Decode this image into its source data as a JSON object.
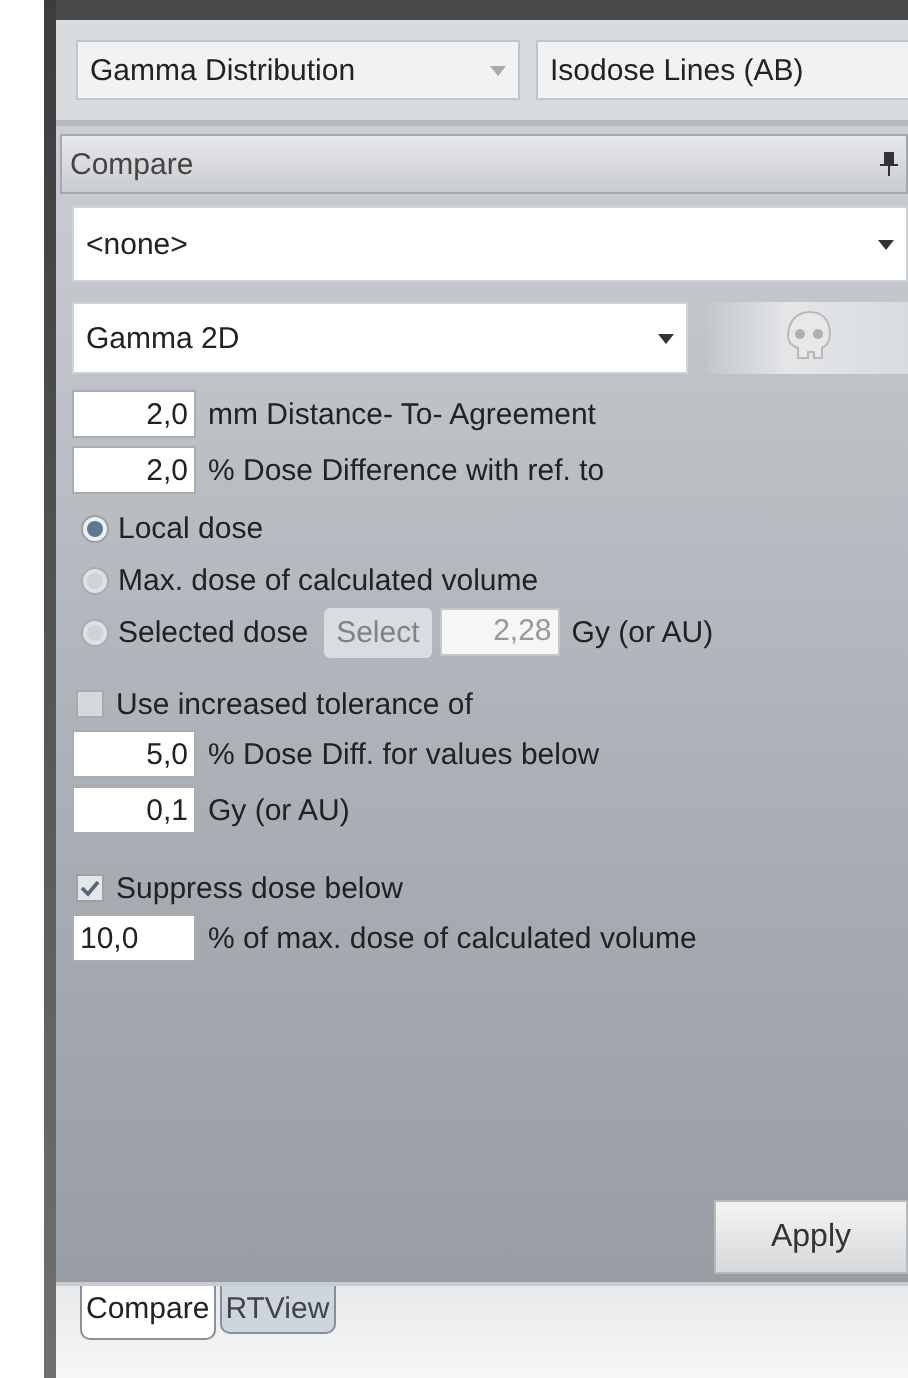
{
  "view_selectors": [
    {
      "kind": "dropdown",
      "value": "Gamma Distribution"
    },
    {
      "kind": "field",
      "value": "Isodose Lines (AB)"
    }
  ],
  "panel": {
    "title": "Compare"
  },
  "reference_select": {
    "value": "<none>"
  },
  "method_select": {
    "value": "Gamma 2D"
  },
  "params": [
    {
      "number": "2,0",
      "text": "mm Distance- To- Agreement"
    },
    {
      "number": "2,0",
      "text": "% Dose Difference with ref. to"
    }
  ],
  "reference_options": [
    {
      "kind": "plain",
      "label": "Local dose",
      "selected": true
    },
    {
      "kind": "plain",
      "label": "Max. dose of calculated volume",
      "selected": false
    },
    {
      "kind": "dose",
      "label": "Selected dose",
      "selected": false,
      "select_button": {
        "label": "Select",
        "disabled": true
      },
      "dose_value": "2,28",
      "unit": "Gy (or AU)"
    }
  ],
  "tolerance": {
    "label": "Use increased tolerance of",
    "checked": false,
    "fields": [
      {
        "number": "5,0",
        "text": "% Dose Diff. for values below"
      },
      {
        "number": "0,1",
        "text": "Gy (or AU)"
      }
    ]
  },
  "suppress": {
    "label": "Suppress dose below",
    "checked": true,
    "value": "10,0",
    "unit": "% of max. dose of calculated volume"
  },
  "apply_button": "Apply",
  "tabs": [
    {
      "label": "Compare",
      "selected": true
    },
    {
      "label": "RTView",
      "selected": false
    }
  ]
}
